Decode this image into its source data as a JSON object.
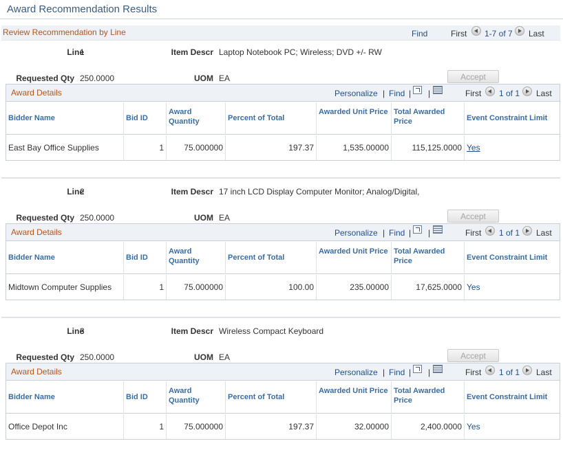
{
  "page": {
    "title": "Award Recommendation Results"
  },
  "review": {
    "title": "Review Recommendation by Line",
    "find_label": "Find",
    "nav": {
      "first": "First",
      "range": "1-7 of 7",
      "last": "Last"
    }
  },
  "labels": {
    "line": "Line",
    "item_descr": "Item Descr",
    "requested_qty": "Requested Qty",
    "uom": "UOM",
    "accept": "Accept"
  },
  "grid_labels": {
    "title": "Award Details",
    "personalize": "Personalize",
    "find": "Find",
    "separator": "|",
    "first": "First",
    "range": "1 of 1",
    "last": "Last",
    "columns": [
      "Bidder Name",
      "Bid ID",
      "Award Quantity",
      "Percent of Total",
      "Awarded Unit Price",
      "Total Awarded Price",
      "Event Constraint Limit"
    ]
  },
  "lines": [
    {
      "line": "1",
      "item_descr": "Laptop Notebook PC; Wireless; DVD +/- RW",
      "requested_qty": "250.0000",
      "uom": "EA",
      "row": {
        "bidder_name": "East Bay Office Supplies",
        "bid_id": "1",
        "award_quantity": "75.000000",
        "percent_of_total": "197.37",
        "awarded_unit_price": "1,535.00000",
        "total_awarded_price": "115,125.0000",
        "event_constraint_limit": "Yes"
      }
    },
    {
      "line": "2",
      "item_descr": "17 inch LCD Display Computer Monitor; Analog/Digital,",
      "requested_qty": "250.0000",
      "uom": "EA",
      "row": {
        "bidder_name": "Midtown Computer Supplies",
        "bid_id": "1",
        "award_quantity": "75.000000",
        "percent_of_total": "100.00",
        "awarded_unit_price": "235.00000",
        "total_awarded_price": "17,625.0000",
        "event_constraint_limit": "Yes"
      }
    },
    {
      "line": "3",
      "item_descr": "Wireless Compact Keyboard",
      "requested_qty": "250.0000",
      "uom": "EA",
      "row": {
        "bidder_name": "Office Depot Inc",
        "bid_id": "1",
        "award_quantity": "75.000000",
        "percent_of_total": "197.37",
        "awarded_unit_price": "32.00000",
        "total_awarded_price": "2,400.0000",
        "event_constraint_limit": "Yes"
      }
    }
  ]
}
